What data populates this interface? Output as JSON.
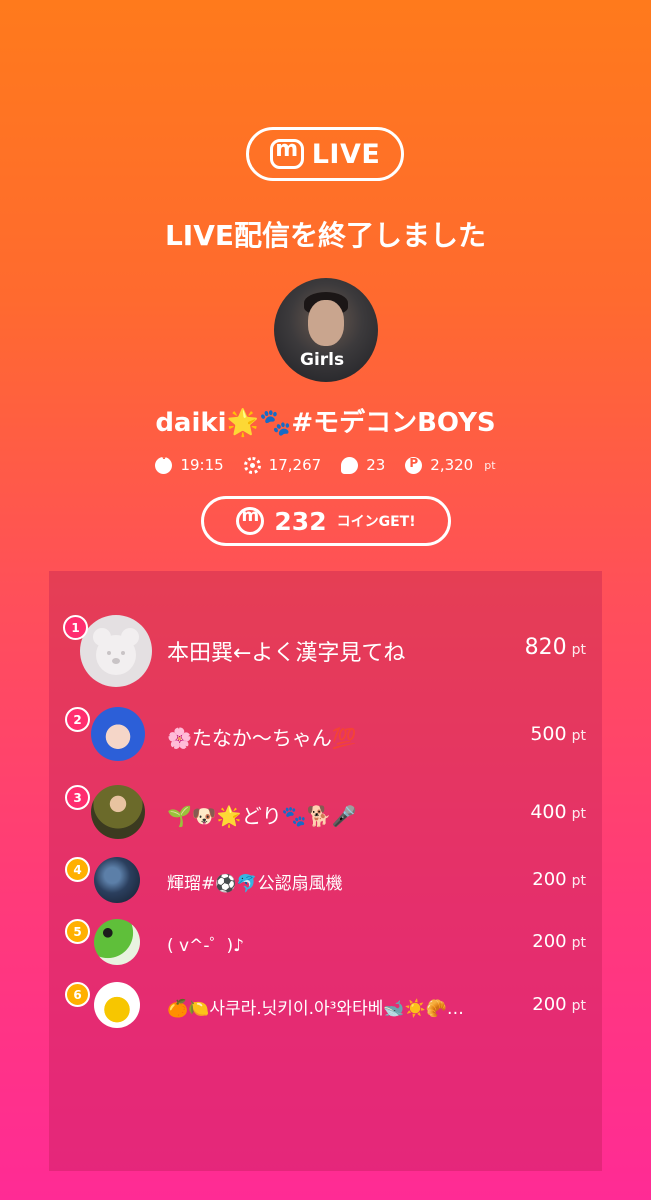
{
  "brand": {
    "logo_icon": "m-logo-icon",
    "label": "LIVE"
  },
  "headline": "LIVE配信を終了しました",
  "host": {
    "name": "daiki🌟🐾#モデコンBOYS",
    "avatar_caption": "Girls"
  },
  "stats": {
    "duration": "19:15",
    "views": "17,267",
    "comments": "23",
    "points": "2,320",
    "points_unit": "pt"
  },
  "coin": {
    "amount": "232",
    "label": "コインGET!"
  },
  "ranking": [
    {
      "rank": "1",
      "name": "本田巽←よく漢字見てね",
      "points": "820",
      "unit": "pt",
      "badge_color": "#ff2d6f"
    },
    {
      "rank": "2",
      "name": "🌸たなか〜ちゃん💯",
      "points": "500",
      "unit": "pt",
      "badge_color": "#ff2d6f"
    },
    {
      "rank": "3",
      "name": "🌱🐶🌟どり🐾🐕🎤",
      "points": "400",
      "unit": "pt",
      "badge_color": "#ff2d6f"
    },
    {
      "rank": "4",
      "name": "輝瑠#⚽🐬公認扇風機",
      "points": "200",
      "unit": "pt",
      "badge_color": "#ffb000"
    },
    {
      "rank": "5",
      "name": "( v^-゜)♪",
      "points": "200",
      "unit": "pt",
      "badge_color": "#ffb000"
    },
    {
      "rank": "6",
      "name": "🍊🍋사쿠라.닛키이.아³와타베🐋☀️🥐…",
      "points": "200",
      "unit": "pt",
      "badge_color": "#ffb000"
    }
  ]
}
